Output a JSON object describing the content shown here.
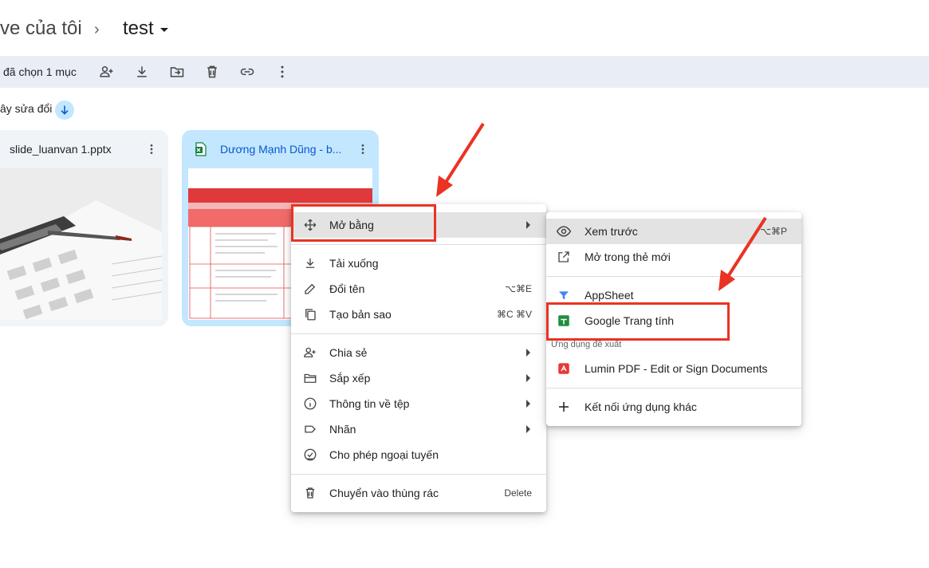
{
  "breadcrumb": {
    "root": "ve của tôi",
    "separator": "›",
    "current": "test"
  },
  "toolbar": {
    "selected_label": "đã chọn 1 mục",
    "actions": [
      "share-icon",
      "download-icon",
      "move-icon",
      "trash-icon",
      "link-icon",
      "more-icon"
    ]
  },
  "sort": {
    "label": "ây sửa đổi",
    "direction_icon": "arrow-down-icon"
  },
  "files": [
    {
      "name": "slide_luanvan 1.pptx",
      "selected": false
    },
    {
      "name": "Dương Mạnh Dũng - b...",
      "selected": true,
      "type_icon": "excel-icon"
    }
  ],
  "context_menu": {
    "items": [
      {
        "label": "Mở bằng",
        "icon": "open-with-icon",
        "submenu": true,
        "highlighted": true
      },
      {
        "label": "Tải xuống",
        "icon": "download-icon"
      },
      {
        "label": "Đổi tên",
        "icon": "rename-icon",
        "shortcut": "⌥⌘E"
      },
      {
        "label": "Tạo bản sao",
        "icon": "copy-icon",
        "shortcut": "⌘C ⌘V"
      },
      {
        "label": "Chia sẻ",
        "icon": "share-icon",
        "submenu": true
      },
      {
        "label": "Sắp xếp",
        "icon": "folder-icon",
        "submenu": true
      },
      {
        "label": "Thông tin về tệp",
        "icon": "info-icon",
        "submenu": true
      },
      {
        "label": "Nhãn",
        "icon": "label-icon",
        "submenu": true
      },
      {
        "label": "Cho phép ngoại tuyến",
        "icon": "offline-icon"
      },
      {
        "label": "Chuyển vào thùng rác",
        "icon": "trash-icon",
        "shortcut": "Delete"
      }
    ]
  },
  "open_with_menu": {
    "items": [
      {
        "label": "Xem trước",
        "icon": "eye-icon",
        "shortcut": "⌥⌘P",
        "highlighted": true
      },
      {
        "label": "Mở trong thẻ mới",
        "icon": "open-new-tab-icon"
      },
      {
        "label": "AppSheet",
        "icon": "appsheet-icon"
      },
      {
        "label": "Google Trang tính",
        "icon": "google-sheets-icon"
      },
      {
        "label": "Lumin PDF - Edit or Sign Documents",
        "icon": "lumin-pdf-icon"
      },
      {
        "label": "Kết nối ứng dụng khác",
        "icon": "plus-icon"
      }
    ],
    "suggested_header": "Ứng dụng đề xuất"
  },
  "colors": {
    "toolbar_bg": "#e9eef6",
    "selected_card": "#c2e7ff",
    "annotation": "#ea3323",
    "sheets_green": "#1e8e3e",
    "excel_green": "#107c41",
    "lumin_red": "#e53935"
  }
}
